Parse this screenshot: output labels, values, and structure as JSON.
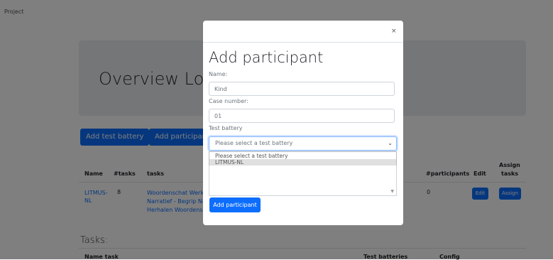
{
  "nav": {
    "project_label": "Project"
  },
  "overview": {
    "title": "Overview Logopedie"
  },
  "actions": {
    "add_test_battery": "Add test battery",
    "add_participant": "Add participant"
  },
  "table": {
    "headers": {
      "name": "Name",
      "tasks_count": "#tasks",
      "tasks": "tasks",
      "participants": "#participants",
      "edit": "Edit",
      "assign_line1": "Assign",
      "assign_line2": "tasks"
    },
    "row": {
      "name_line1": "LITMUS-",
      "name_line2": "NL",
      "tasks_count": "8",
      "task_line1": "Woordenschat Werkwoorden",
      "task_line2": "Narratief - Begrip Narratief",
      "task_line3": "Herhalen Woordenschat",
      "participants": "0",
      "edit_label": "Edit",
      "assign_label": "Assign"
    }
  },
  "tasks_section": {
    "title": "Tasks:",
    "col_name_task": "Name task",
    "col_test_batteries": "Test batteries",
    "col_config": "Config"
  },
  "modal": {
    "close_symbol": "×",
    "title": "Add participant",
    "name_label": "Name:",
    "name_value": "Kind",
    "case_label": "Case number:",
    "case_value": "01",
    "battery_label": "Test battery",
    "battery_selected": "Please select a test battery",
    "battery_options": [
      "Please select a test battery",
      "LITMUS-NL"
    ],
    "submit_label": "Add participant"
  },
  "colors": {
    "primary": "#0d6efd",
    "overlay": "rgba(0,0,0,0.5)",
    "jumbotron": "#e9ecef"
  }
}
